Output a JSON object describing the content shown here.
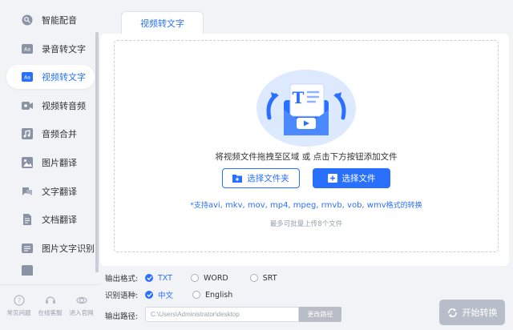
{
  "sidebar": {
    "items": [
      {
        "label": "智能配音",
        "icon": "voice-icon"
      },
      {
        "label": "录音转文字",
        "icon": "audio-to-text-icon"
      },
      {
        "label": "视频转文字",
        "icon": "video-to-text-icon",
        "active": true
      },
      {
        "label": "视频转音频",
        "icon": "video-to-audio-icon"
      },
      {
        "label": "音频合并",
        "icon": "audio-merge-icon"
      },
      {
        "label": "图片翻译",
        "icon": "image-translate-icon"
      },
      {
        "label": "文字翻译",
        "icon": "text-translate-icon"
      },
      {
        "label": "文档翻译",
        "icon": "doc-translate-icon"
      },
      {
        "label": "图片文字识别",
        "icon": "ocr-icon"
      }
    ],
    "footer": [
      {
        "label": "常见问题",
        "icon": "help-icon"
      },
      {
        "label": "在线客服",
        "icon": "support-icon"
      },
      {
        "label": "进入官网",
        "icon": "website-icon"
      }
    ]
  },
  "main": {
    "tab_label": "视频转文字",
    "drop_hint": "将视频文件拖拽至区域 或 点击下方按钮添加文件",
    "btn_folder": "选择文件夹",
    "btn_file": "选择文件",
    "formats_prefix": "*支持",
    "formats_list": "avi, mkv, mov, mp4, mpeg, rmvb, vob, wmv",
    "formats_suffix": "格式的转换",
    "limit": "最多可批量上传8个文件"
  },
  "options": {
    "format_label": "输出格式:",
    "formats": [
      {
        "label": "TXT",
        "checked": true
      },
      {
        "label": "WORD",
        "checked": false
      },
      {
        "label": "SRT",
        "checked": false
      }
    ],
    "language_label": "识别语种:",
    "languages": [
      {
        "label": "中文",
        "checked": true
      },
      {
        "label": "English",
        "checked": false
      }
    ],
    "path_label": "输出路径:",
    "path_value": "C:\\Users\\Administrator\\desktop",
    "path_button": "更改路径",
    "start_button": "开始转换"
  },
  "colors": {
    "accent": "#2a70ff",
    "sidebar_bg": "#f1f3f7",
    "disabled": "#b8bec9"
  }
}
